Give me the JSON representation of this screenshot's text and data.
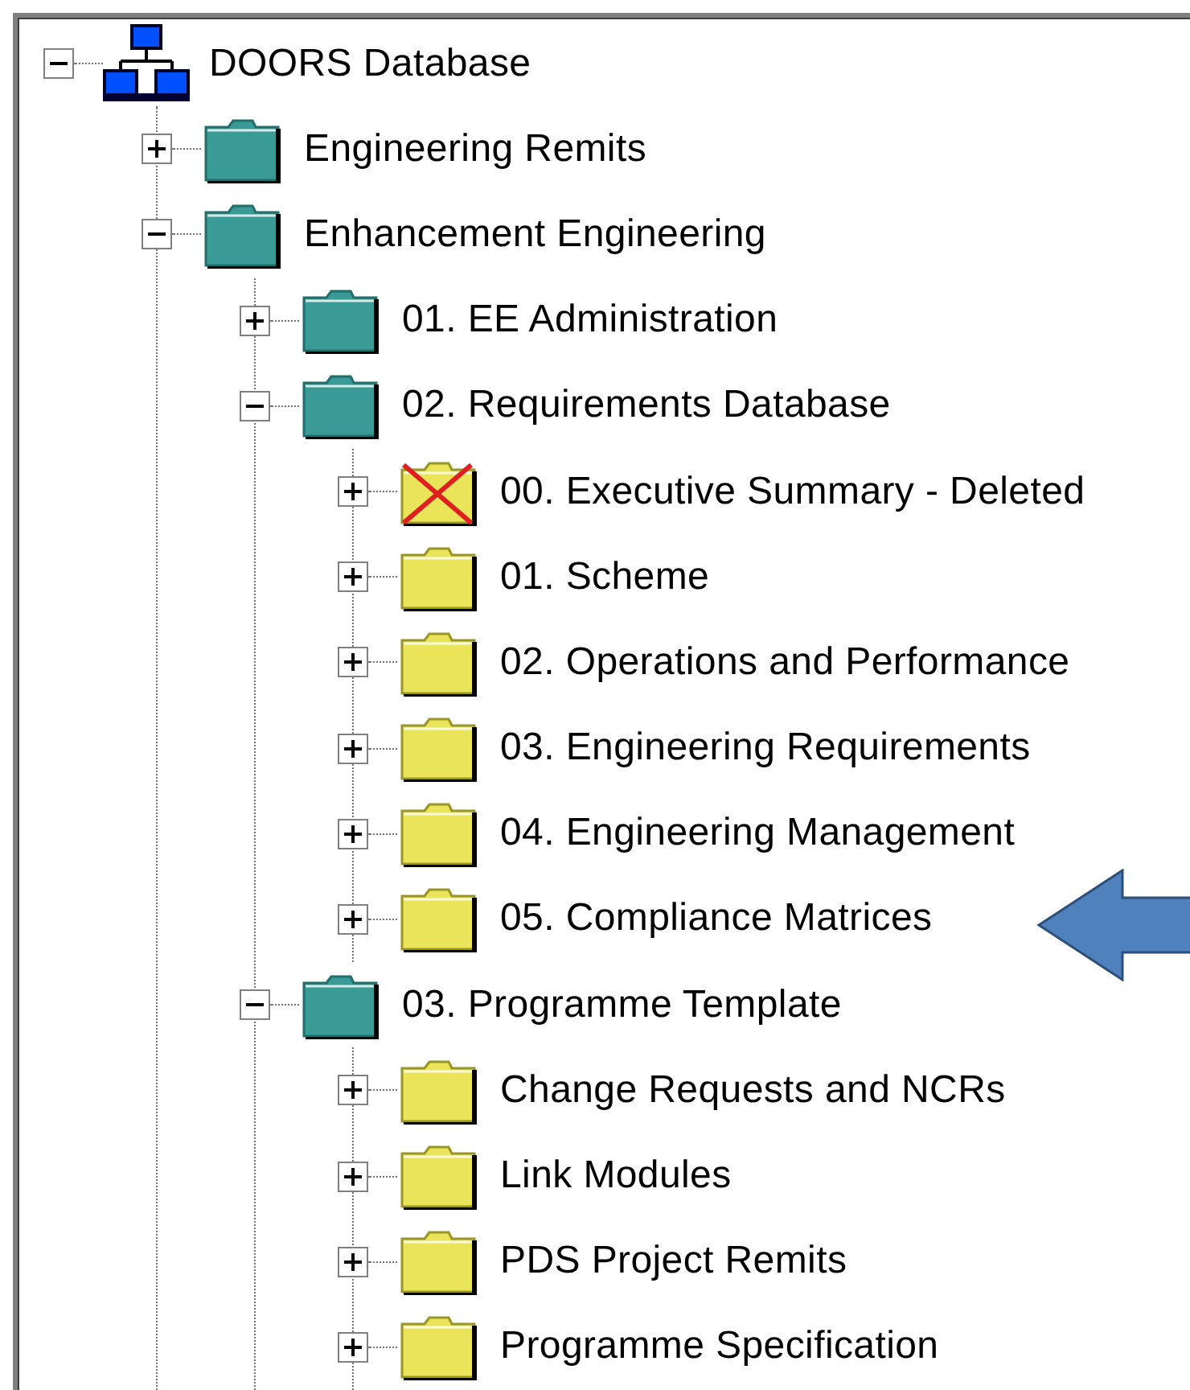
{
  "tree": [
    {
      "label": "DOORS Database",
      "kind": "database",
      "expanded": true,
      "children": [
        {
          "label": "Engineering Remits",
          "kind": "project",
          "expanded": false
        },
        {
          "label": "Enhancement Engineering",
          "kind": "project",
          "expanded": true,
          "children": [
            {
              "label": "01. EE Administration",
              "kind": "project",
              "expanded": false
            },
            {
              "label": "02. Requirements Database",
              "kind": "project",
              "expanded": true,
              "children": [
                {
                  "label": "00. Executive Summary - Deleted",
                  "kind": "deleted",
                  "expanded": false
                },
                {
                  "label": "01. Scheme",
                  "kind": "folder",
                  "expanded": false
                },
                {
                  "label": "02. Operations and Performance",
                  "kind": "folder",
                  "expanded": false
                },
                {
                  "label": "03. Engineering Requirements",
                  "kind": "folder",
                  "expanded": false
                },
                {
                  "label": "04. Engineering Management",
                  "kind": "folder",
                  "expanded": false
                },
                {
                  "label": "05. Compliance Matrices",
                  "kind": "folder",
                  "expanded": false,
                  "pointed_at": true
                }
              ]
            },
            {
              "label": "03. Programme Template",
              "kind": "project",
              "expanded": true,
              "children": [
                {
                  "label": "Change Requests and NCRs",
                  "kind": "folder",
                  "expanded": false
                },
                {
                  "label": "Link Modules",
                  "kind": "folder",
                  "expanded": false
                },
                {
                  "label": "PDS Project Remits",
                  "kind": "folder",
                  "expanded": false
                },
                {
                  "label": "Programme Specification",
                  "kind": "folder",
                  "expanded": false
                }
              ]
            }
          ]
        }
      ]
    }
  ]
}
